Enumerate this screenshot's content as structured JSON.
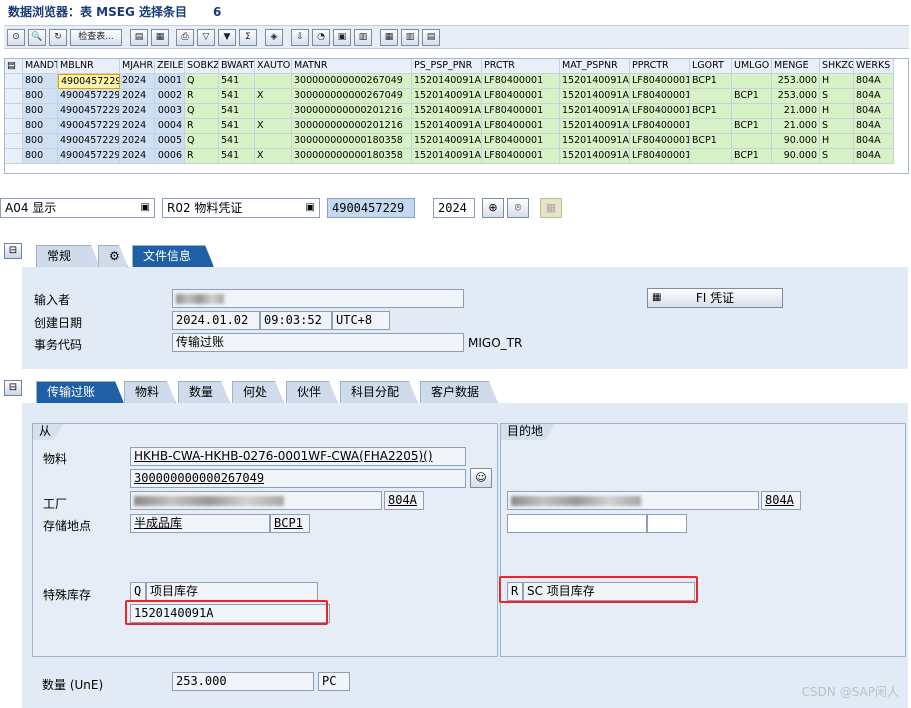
{
  "title": {
    "text": "数据浏览器：表 MSEG 选择条目",
    "count": "6"
  },
  "toolbar": {
    "check_table_label": "检查表...",
    "icons": [
      "glasses-icon",
      "display-icon",
      "refresh-icon",
      "check-table-button",
      "details-icon",
      "select-all-icon",
      "print-icon",
      "filter-icon",
      "filter-settings-icon",
      "sum-icon",
      "layout-icon",
      "export-icon",
      "graph-icon",
      "abc-analysis-icon",
      "excel-icon",
      "grid-layout-icon",
      "column-icon",
      "row-icon"
    ]
  },
  "grid": {
    "columns": [
      "MANDT",
      "MBLNR",
      "MJAHR",
      "ZEILE",
      "SOBKZ",
      "BWART",
      "XAUTO",
      "MATNR",
      "PS_PSP_PNR",
      "PRCTR",
      "MAT_PSPNR",
      "PPRCTR",
      "LGORT",
      "UMLGO",
      "MENGE",
      "SHKZG",
      "WERKS"
    ],
    "rows": [
      [
        "800",
        "4900457229",
        "2024",
        "0001",
        "Q",
        "541",
        "",
        "300000000000267049",
        "1520140091A",
        "LF80400001",
        "1520140091A",
        "LF80400001",
        "BCP1",
        "",
        "253.000",
        "H",
        "804A"
      ],
      [
        "800",
        "4900457229",
        "2024",
        "0002",
        "R",
        "541",
        "X",
        "300000000000267049",
        "1520140091A",
        "LF80400001",
        "1520140091A",
        "LF80400001",
        "",
        "BCP1",
        "253.000",
        "S",
        "804A"
      ],
      [
        "800",
        "4900457229",
        "2024",
        "0003",
        "Q",
        "541",
        "",
        "300000000000201216",
        "1520140091A",
        "LF80400001",
        "1520140091A",
        "LF80400001",
        "BCP1",
        "",
        "21.000",
        "H",
        "804A"
      ],
      [
        "800",
        "4900457229",
        "2024",
        "0004",
        "R",
        "541",
        "X",
        "300000000000201216",
        "1520140091A",
        "LF80400001",
        "1520140091A",
        "LF80400001",
        "",
        "BCP1",
        "21.000",
        "S",
        "804A"
      ],
      [
        "800",
        "4900457229",
        "2024",
        "0005",
        "Q",
        "541",
        "",
        "300000000000180358",
        "1520140091A",
        "LF80400001",
        "1520140091A",
        "LF80400001",
        "BCP1",
        "",
        "90.000",
        "H",
        "804A"
      ],
      [
        "800",
        "4900457229",
        "2024",
        "0006",
        "R",
        "541",
        "X",
        "300000000000180358",
        "1520140091A",
        "LF80400001",
        "1520140091A",
        "LF80400001",
        "",
        "BCP1",
        "90.000",
        "S",
        "804A"
      ]
    ]
  },
  "selection": {
    "mode": "A04 显示",
    "doc_type": "R02 物料凭证",
    "doc_number": "4900457229",
    "year": "2024"
  },
  "header_tabs": [
    "常规",
    "文件信息"
  ],
  "header": {
    "entered_by_label": "输入者",
    "created_on_label": "创建日期",
    "created_date": "2024.01.02",
    "created_time": "09:03:52",
    "timezone": "UTC+8",
    "transaction_label": "事务代码",
    "transaction_text": "传输过账",
    "transaction_code": "MIGO_TR",
    "fi_button": "FI 凭证"
  },
  "item_tabs": [
    "传输过账",
    "物料",
    "数量",
    "何处",
    "伙伴",
    "科目分配",
    "客户数据"
  ],
  "from": {
    "group_label": "从",
    "material_label": "物料",
    "material_desc": "HKHB-CWA-HKHB-0276-0001WF-CWA(FHA2205)()",
    "material_number": "300000000000267049",
    "plant_label": "工厂",
    "plant_code": "804A",
    "storage_label": "存储地点",
    "storage_desc": "半成品库",
    "storage_code": "BCP1",
    "special_stock_label": "特殊库存",
    "special_stock_code": "Q",
    "special_stock_desc": "项目库存",
    "wbs": "1520140091A"
  },
  "to": {
    "group_label": "目的地",
    "plant_code": "804A",
    "special_stock_code": "R",
    "special_stock_desc": "SC 项目库存"
  },
  "quantity": {
    "label": "数量 (UnE)",
    "value": "253.000",
    "unit": "PC"
  },
  "watermark": "CSDN @SAP闲人"
}
